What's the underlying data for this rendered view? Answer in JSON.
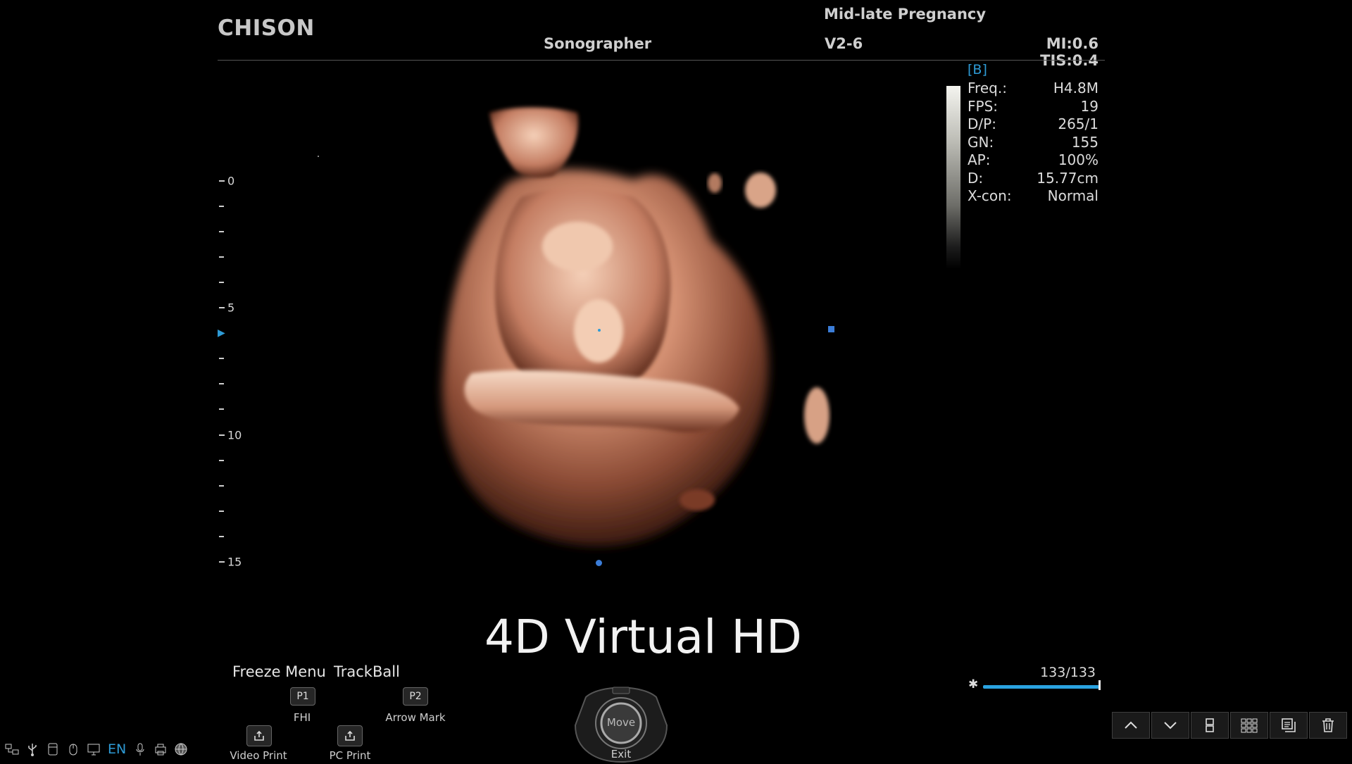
{
  "header": {
    "brand": "CHISON",
    "preset": "Mid-late Pregnancy",
    "operator": "Sonographer",
    "probe": "V2-6",
    "safety": "MI:0.6 TIS:0.4"
  },
  "params": {
    "mode": "[B]",
    "rows": [
      {
        "label": "Freq.:",
        "value": "H4.8M"
      },
      {
        "label": "FPS:",
        "value": "19"
      },
      {
        "label": "D/P:",
        "value": "265/1"
      },
      {
        "label": "GN:",
        "value": "155"
      },
      {
        "label": "AP:",
        "value": "100%"
      },
      {
        "label": "D:",
        "value": "15.77cm"
      },
      {
        "label": "X-con:",
        "value": "Normal"
      }
    ]
  },
  "depth_scale": {
    "labels": [
      "0",
      "5",
      "10",
      "15"
    ],
    "focus_marker": "▶"
  },
  "overlay_title": "4D Virtual HD",
  "menu": {
    "freeze_menu": "Freeze Menu",
    "trackball_title": "TrackBall",
    "p1": {
      "key": "P1",
      "label": "FHI"
    },
    "p2": {
      "key": "P2",
      "label": "Arrow Mark"
    },
    "video_print": "Video Print",
    "pc_print": "PC Print"
  },
  "trackball": {
    "center": "Move",
    "bottom": "Exit"
  },
  "cine": {
    "count": "133/133",
    "progress": 1.0,
    "star": "✱"
  },
  "toolbar": {
    "icons": [
      "chevron-up-icon",
      "chevron-down-icon",
      "single-layout-icon",
      "grid-layout-icon",
      "copy-icon",
      "trash-icon"
    ]
  },
  "status_bar": {
    "language": "EN",
    "icons": [
      "network-icon",
      "usb-icon",
      "storage-icon",
      "mouse-icon",
      "monitor-icon",
      "microphone-icon",
      "printer-icon",
      "globe-icon"
    ]
  },
  "colors": {
    "accent": "#2e9bd6",
    "marker": "#3b7dd8",
    "background": "#000000"
  }
}
